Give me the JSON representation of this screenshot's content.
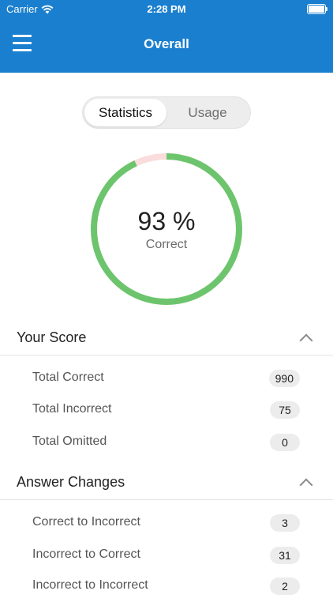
{
  "status_bar": {
    "carrier": "Carrier",
    "time": "2:28 PM"
  },
  "nav": {
    "title": "Overall",
    "menu_icon": "hamburger-menu-icon"
  },
  "segmented": {
    "active": "Statistics",
    "inactive": "Usage"
  },
  "summary": {
    "percent_text": "93 %",
    "label": "Correct",
    "correct_fraction": 0.93,
    "colors": {
      "correct": "#6cc56c",
      "incorrect": "#fadcdc",
      "header": "#1a7fcf"
    }
  },
  "your_score": {
    "title": "Your Score",
    "rows": [
      {
        "label": "Total Correct",
        "value": "990"
      },
      {
        "label": "Total Incorrect",
        "value": "75"
      },
      {
        "label": "Total Omitted",
        "value": "0"
      }
    ]
  },
  "answer_changes": {
    "title": "Answer Changes",
    "rows": [
      {
        "label": "Correct to Incorrect",
        "value": "3"
      },
      {
        "label": "Incorrect to Correct",
        "value": "31"
      },
      {
        "label": "Incorrect to Incorrect",
        "value": "2"
      }
    ]
  }
}
